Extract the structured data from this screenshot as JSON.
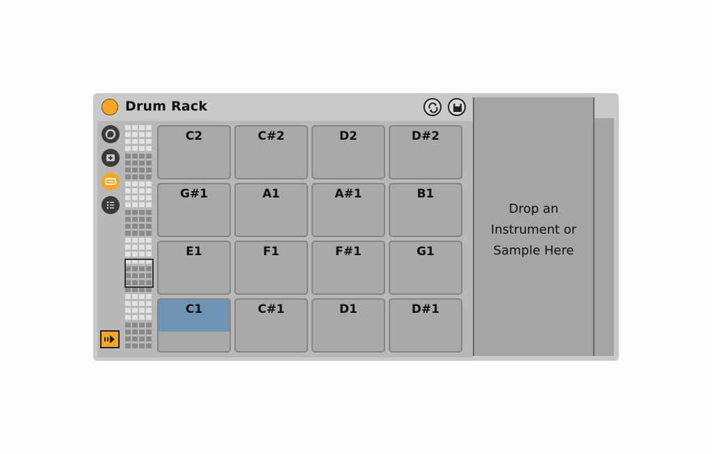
{
  "device": {
    "title": "Drum Rack",
    "power_color": "#f5a623",
    "accent_color": "#f5a623",
    "selected_pad_color": "#6f94b4"
  },
  "titlebar_buttons": [
    {
      "name": "hot-swap-icon"
    },
    {
      "name": "save-preset-icon"
    }
  ],
  "side_icons": [
    {
      "name": "macro-knob-icon",
      "active": false
    },
    {
      "name": "randomize-icon",
      "active": false
    },
    {
      "name": "input-routing-icon",
      "active": true
    },
    {
      "name": "chain-list-icon",
      "active": false
    }
  ],
  "follow_button": {
    "name": "auto-select-icon",
    "active": true
  },
  "pads": {
    "rows": [
      [
        "C2",
        "C#2",
        "D2",
        "D#2"
      ],
      [
        "G#1",
        "A1",
        "A#1",
        "B1"
      ],
      [
        "E1",
        "F1",
        "F#1",
        "G1"
      ],
      [
        "C1",
        "C#1",
        "D1",
        "D#1"
      ]
    ],
    "selected": "C1"
  },
  "drop_zone": {
    "line1": "Drop an",
    "line2": "Instrument or",
    "line3": "Sample Here"
  }
}
